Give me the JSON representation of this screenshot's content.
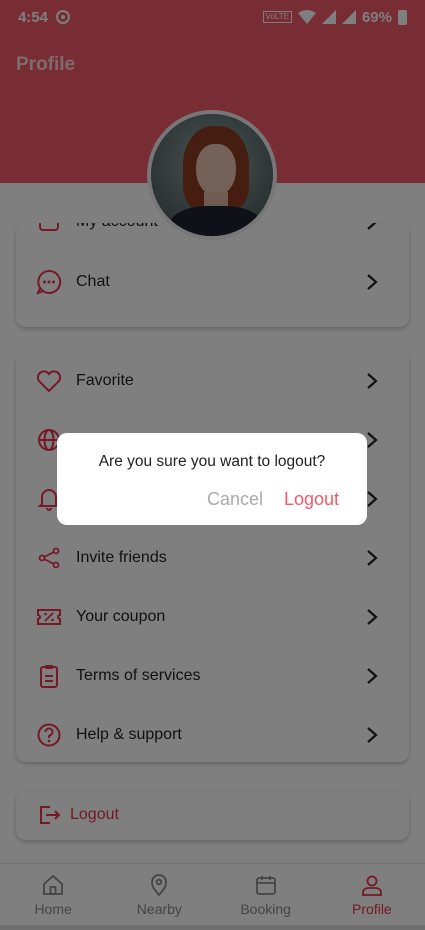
{
  "status_bar": {
    "time": "4:54",
    "battery": "69%",
    "volte": "VoLTE",
    "icons": [
      "record-icon",
      "volte-icon",
      "wifi-icon",
      "signal-icon",
      "signal-icon",
      "battery-icon"
    ]
  },
  "header": {
    "title": "Profile"
  },
  "menu_card_1": {
    "items": [
      {
        "label": "My account",
        "icon": "user-card-icon"
      },
      {
        "label": "Chat",
        "icon": "chat-icon"
      }
    ]
  },
  "menu_card_2": {
    "items": [
      {
        "label": "Favorite",
        "icon": "heart-icon"
      },
      {
        "label": "",
        "icon": "globe-icon"
      },
      {
        "label": "",
        "icon": "bell-icon"
      },
      {
        "label": "Invite friends",
        "icon": "share-icon"
      },
      {
        "label": "Your coupon",
        "icon": "coupon-icon"
      },
      {
        "label": "Terms of services",
        "icon": "clipboard-icon"
      },
      {
        "label": "Help & support",
        "icon": "help-icon"
      }
    ]
  },
  "logout_card": {
    "label": "Logout",
    "icon": "logout-icon"
  },
  "dialog": {
    "message": "Are you sure you want to logout?",
    "cancel_label": "Cancel",
    "confirm_label": "Logout"
  },
  "bottom_nav": {
    "items": [
      {
        "label": "Home",
        "icon": "home-icon",
        "active": false
      },
      {
        "label": "Nearby",
        "icon": "location-icon",
        "active": false
      },
      {
        "label": "Booking",
        "icon": "calendar-icon",
        "active": false
      },
      {
        "label": "Profile",
        "icon": "profile-icon",
        "active": true
      }
    ]
  },
  "colors": {
    "primary": "#f05a6a",
    "accent": "#e8324b",
    "muted": "#888888"
  }
}
